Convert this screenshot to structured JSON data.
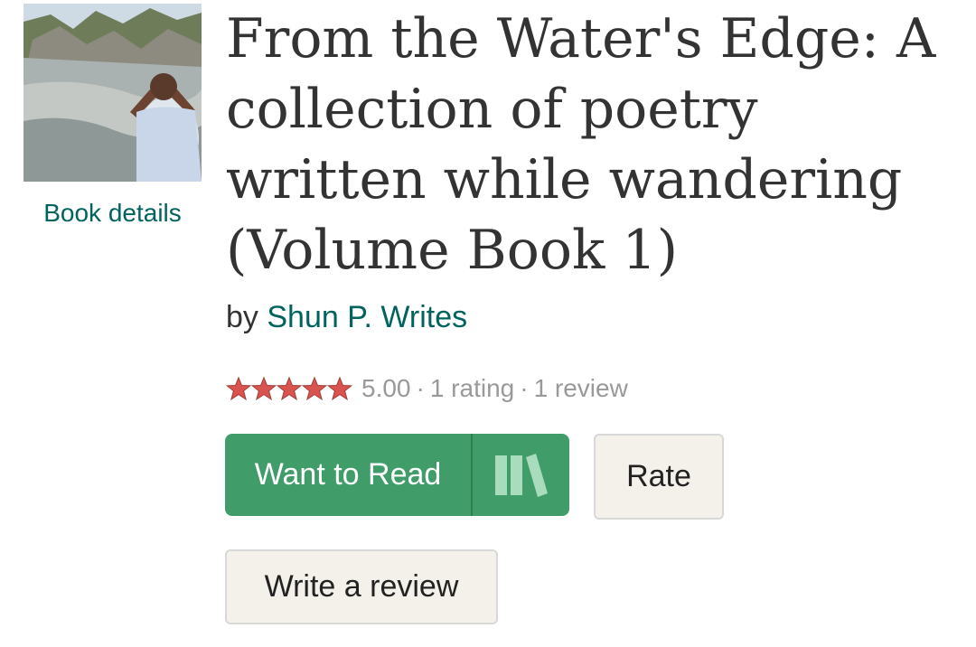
{
  "cover": {
    "link_label": "Book details",
    "icon": "book-cover-image"
  },
  "book": {
    "title": "From the Water's Edge: A collection of poetry written while wandering (Volume Book 1)",
    "by_label": "by",
    "author": "Shun P. Writes"
  },
  "rating": {
    "stars": 5,
    "max_stars": 5,
    "star_color": "#d9534f",
    "average": "5.00",
    "separator": "·",
    "ratings_text": "1 rating",
    "reviews_text": "1 review"
  },
  "actions": {
    "want_to_read": "Want to Read",
    "shelf_icon": "bookshelf-icon",
    "rate": "Rate",
    "write_review": "Write a review"
  },
  "colors": {
    "link": "#00635d",
    "want_button": "#409d69",
    "secondary_button": "#f4f1ea",
    "text": "#333333",
    "muted": "#999999"
  }
}
